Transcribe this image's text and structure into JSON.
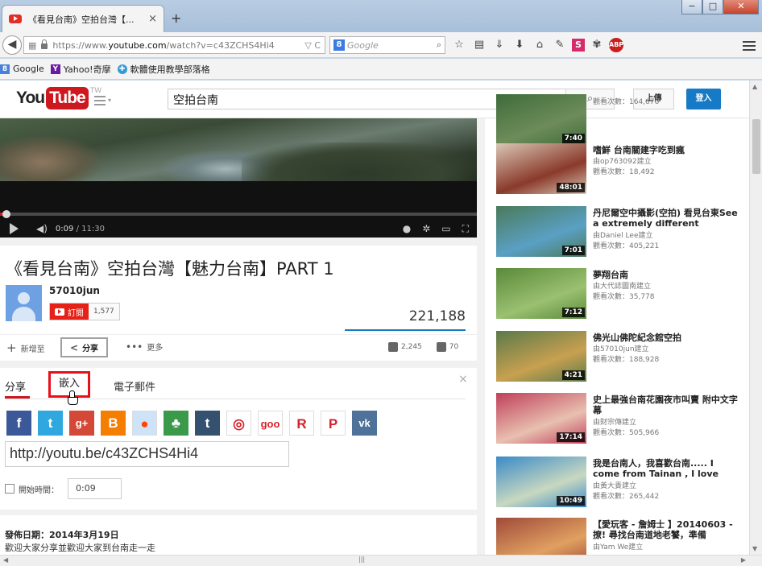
{
  "browser": {
    "tab_title": "《看見台南》空拍台灣【...",
    "tab_close": "×",
    "new_tab": "+",
    "url_prefix": "https://www.",
    "url_domain": "youtube.com",
    "url_rest": "/watch?v=c43ZCHS4Hi4",
    "url_buttons": "▽ C",
    "search_placeholder": "Google",
    "window": {
      "min": "−",
      "max": "□",
      "close": "✕"
    },
    "bookmarks": [
      {
        "label": "Google",
        "icon": "google-icon",
        "glyph": "8"
      },
      {
        "label": "Yahoo!奇摩",
        "icon": "yahoo-icon",
        "glyph": "Y"
      },
      {
        "label": "軟體使用教學部落格",
        "icon": "blog-icon",
        "glyph": "✚"
      }
    ]
  },
  "youtube": {
    "logo_you": "You",
    "logo_tube": "Tube",
    "logo_region": "TW",
    "search_value": "空拍台南",
    "upload_label": "上傳",
    "login_label": "登入"
  },
  "player": {
    "current_time": "0:09",
    "duration": "/ 11:30",
    "progress": 0.013
  },
  "video": {
    "title": "《看見台南》空拍台灣【魅力台南】PART 1",
    "channel": "57010jun",
    "subscribe_label": "訂閱",
    "subscriber_count": "1,577",
    "views": "221,188",
    "add_to_label": "新增至",
    "share_label": "分享",
    "more_label": "更多",
    "likes": "2,245",
    "dislikes": "70"
  },
  "share_panel": {
    "tab_share": "分享",
    "tab_embed": "嵌入",
    "tab_email": "電子郵件",
    "close": "×",
    "url": "http://youtu.be/c43ZCHS4Hi4",
    "start_time_label": "開始時間：",
    "start_time_value": "0:09",
    "socials": [
      {
        "name": "facebook-icon",
        "glyph": "f",
        "color": "#3b5998"
      },
      {
        "name": "twitter-icon",
        "glyph": "t",
        "color": "#2fa8e0"
      },
      {
        "name": "google-plus-icon",
        "glyph": "g+",
        "color": "#d34836"
      },
      {
        "name": "blogger-icon",
        "glyph": "B",
        "color": "#f57d00"
      },
      {
        "name": "reddit-icon",
        "glyph": "●",
        "color": "#cee3f8"
      },
      {
        "name": "wretch-icon",
        "glyph": "♣",
        "color": "#3a9a4a"
      },
      {
        "name": "tumblr-icon",
        "glyph": "t",
        "color": "#34526f"
      },
      {
        "name": "weibo-icon",
        "glyph": "◎",
        "color": "#ffffff"
      },
      {
        "name": "goo-icon",
        "glyph": "goo",
        "color": "#ffffff"
      },
      {
        "name": "reader-icon",
        "glyph": "R",
        "color": "#ffffff"
      },
      {
        "name": "pinterest-icon",
        "glyph": "P",
        "color": "#ffffff"
      },
      {
        "name": "vk-icon",
        "glyph": "vk",
        "color": "#4e729a"
      }
    ]
  },
  "description": {
    "published": "發佈日期：2014年3月19日",
    "text": "歡迎大家分享並歡迎大家到台南走一走"
  },
  "related": [
    {
      "title": "",
      "by": "",
      "views": "觀看次數：164,676",
      "duration": "7:40",
      "colors": [
        "#3f6b3a",
        "#6d8c5a"
      ]
    },
    {
      "title": "嗜鮮 台南關建字吃到瘋",
      "by": "由op763092建立",
      "views": "觀看次數：18,492",
      "duration": "48:01",
      "colors": [
        "#d9c7b6",
        "#8a3a2a"
      ]
    },
    {
      "title": "丹尼爾空中攝影(空拍) 看見台東See a extremely different",
      "by": "由Daniel Lee建立",
      "views": "觀看次數：405,221",
      "duration": "7:01",
      "colors": [
        "#4a7a5a",
        "#5aa0c4"
      ]
    },
    {
      "title": "夢翔台南",
      "by": "由大代誌圖南建立",
      "views": "觀看次數：35,778",
      "duration": "7:12",
      "colors": [
        "#5a8a3a",
        "#9ac070"
      ]
    },
    {
      "title": "佛光山佛陀紀念館空拍",
      "by": "由57010jun建立",
      "views": "觀看次數：188,928",
      "duration": "4:21",
      "colors": [
        "#5a7a4a",
        "#c8a050"
      ]
    },
    {
      "title": "史上最強台南花園夜市叫賣 附中文字幕",
      "by": "由財宗傳建立",
      "views": "觀看次數：505,966",
      "duration": "17:14",
      "colors": [
        "#c0405a",
        "#e8c0b0"
      ]
    },
    {
      "title": "我是台南人，我喜歡台南..... I come from Tainan , I love",
      "by": "由黃大貴建立",
      "views": "觀看次數：265,442",
      "duration": "10:49",
      "colors": [
        "#3a8ac8",
        "#c8d8c0"
      ]
    },
    {
      "title": "【愛玩客 - 詹姆士 】20140603 - 撩! 尋找台南道地老饕，準備",
      "by": "由Yam We建立",
      "views": "",
      "duration": "",
      "colors": [
        "#a04a3a",
        "#e0a060"
      ]
    }
  ]
}
